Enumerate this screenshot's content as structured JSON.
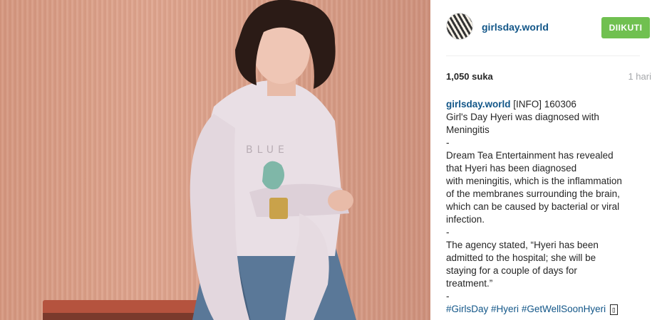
{
  "post": {
    "username": "girlsday.world",
    "follow_label": "DIIKUTI",
    "likes": "1,050 suka",
    "time": "1 hari",
    "caption_user": "girlsday.world",
    "caption_lines": [
      "[INFO] 160306",
      "Girl's Day Hyeri was diagnosed with",
      "Meningitis",
      "-",
      "Dream Tea Entertainment has revealed",
      "that Hyeri has been diagnosed",
      "with meningitis, which is the inflammation",
      "of the membranes surrounding the brain,",
      "which can be caused by bacterial or viral",
      "infection.",
      "-",
      "The agency stated, “Hyeri has been",
      "admitted to the hospital; she will be",
      "staying for a couple of days for",
      "treatment.”",
      "-"
    ],
    "hashtags": [
      "#GirlsDay",
      "#Hyeri",
      "#GetWellSoonHyeri"
    ],
    "trailing_glyph": "▯"
  },
  "colors": {
    "link": "#125688",
    "follow_button": "#70c050",
    "muted": "#a5a7aa"
  },
  "icons": {
    "avatar": "profile-avatar"
  }
}
